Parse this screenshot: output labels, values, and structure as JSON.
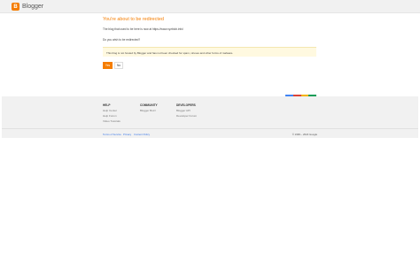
{
  "header": {
    "logo_text": "Blogger",
    "logo_letter": "B"
  },
  "main": {
    "title": "You're about to be redirected",
    "line1": "The blog that used to be here is now at https://www.xyzblob.info/",
    "question": "Do you wish to be redirected?",
    "notice": "This blog is not hosted by Blogger and has not been checked for spam, viruses and other forms of malware.",
    "yes_label": "Yes",
    "no_label": "No"
  },
  "colors": {
    "accent": "#f57d00",
    "bar": [
      "#4285f4",
      "#db4437",
      "#f4b400",
      "#0f9d58"
    ]
  },
  "footer": {
    "columns": [
      {
        "heading": "HELP",
        "links": [
          "Help Center",
          "Help Forum",
          "Video Tutorials"
        ]
      },
      {
        "heading": "COMMUNITY",
        "links": [
          "Blogger Buzz"
        ]
      },
      {
        "heading": "DEVELOPERS",
        "links": [
          "Blogger API",
          "Developer Forum"
        ]
      }
    ],
    "bottom_links": [
      "Terms of Service",
      "Privacy",
      "Content Policy"
    ],
    "copyright": "© 1999 – 2024 Google"
  }
}
